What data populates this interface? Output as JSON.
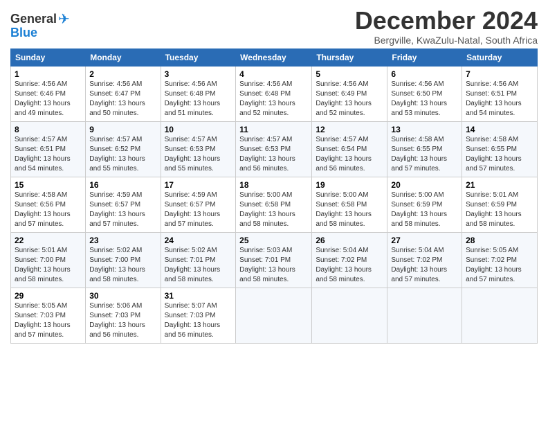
{
  "header": {
    "logo_general": "General",
    "logo_blue": "Blue",
    "title": "December 2024",
    "location": "Bergville, KwaZulu-Natal, South Africa"
  },
  "days_of_week": [
    "Sunday",
    "Monday",
    "Tuesday",
    "Wednesday",
    "Thursday",
    "Friday",
    "Saturday"
  ],
  "weeks": [
    [
      {
        "day": "1",
        "sunrise": "4:56 AM",
        "sunset": "6:46 PM",
        "daylight": "13 hours and 49 minutes."
      },
      {
        "day": "2",
        "sunrise": "4:56 AM",
        "sunset": "6:47 PM",
        "daylight": "13 hours and 50 minutes."
      },
      {
        "day": "3",
        "sunrise": "4:56 AM",
        "sunset": "6:48 PM",
        "daylight": "13 hours and 51 minutes."
      },
      {
        "day": "4",
        "sunrise": "4:56 AM",
        "sunset": "6:48 PM",
        "daylight": "13 hours and 52 minutes."
      },
      {
        "day": "5",
        "sunrise": "4:56 AM",
        "sunset": "6:49 PM",
        "daylight": "13 hours and 52 minutes."
      },
      {
        "day": "6",
        "sunrise": "4:56 AM",
        "sunset": "6:50 PM",
        "daylight": "13 hours and 53 minutes."
      },
      {
        "day": "7",
        "sunrise": "4:56 AM",
        "sunset": "6:51 PM",
        "daylight": "13 hours and 54 minutes."
      }
    ],
    [
      {
        "day": "8",
        "sunrise": "4:57 AM",
        "sunset": "6:51 PM",
        "daylight": "13 hours and 54 minutes."
      },
      {
        "day": "9",
        "sunrise": "4:57 AM",
        "sunset": "6:52 PM",
        "daylight": "13 hours and 55 minutes."
      },
      {
        "day": "10",
        "sunrise": "4:57 AM",
        "sunset": "6:53 PM",
        "daylight": "13 hours and 55 minutes."
      },
      {
        "day": "11",
        "sunrise": "4:57 AM",
        "sunset": "6:53 PM",
        "daylight": "13 hours and 56 minutes."
      },
      {
        "day": "12",
        "sunrise": "4:57 AM",
        "sunset": "6:54 PM",
        "daylight": "13 hours and 56 minutes."
      },
      {
        "day": "13",
        "sunrise": "4:58 AM",
        "sunset": "6:55 PM",
        "daylight": "13 hours and 57 minutes."
      },
      {
        "day": "14",
        "sunrise": "4:58 AM",
        "sunset": "6:55 PM",
        "daylight": "13 hours and 57 minutes."
      }
    ],
    [
      {
        "day": "15",
        "sunrise": "4:58 AM",
        "sunset": "6:56 PM",
        "daylight": "13 hours and 57 minutes."
      },
      {
        "day": "16",
        "sunrise": "4:59 AM",
        "sunset": "6:57 PM",
        "daylight": "13 hours and 57 minutes."
      },
      {
        "day": "17",
        "sunrise": "4:59 AM",
        "sunset": "6:57 PM",
        "daylight": "13 hours and 57 minutes."
      },
      {
        "day": "18",
        "sunrise": "5:00 AM",
        "sunset": "6:58 PM",
        "daylight": "13 hours and 58 minutes."
      },
      {
        "day": "19",
        "sunrise": "5:00 AM",
        "sunset": "6:58 PM",
        "daylight": "13 hours and 58 minutes."
      },
      {
        "day": "20",
        "sunrise": "5:00 AM",
        "sunset": "6:59 PM",
        "daylight": "13 hours and 58 minutes."
      },
      {
        "day": "21",
        "sunrise": "5:01 AM",
        "sunset": "6:59 PM",
        "daylight": "13 hours and 58 minutes."
      }
    ],
    [
      {
        "day": "22",
        "sunrise": "5:01 AM",
        "sunset": "7:00 PM",
        "daylight": "13 hours and 58 minutes."
      },
      {
        "day": "23",
        "sunrise": "5:02 AM",
        "sunset": "7:00 PM",
        "daylight": "13 hours and 58 minutes."
      },
      {
        "day": "24",
        "sunrise": "5:02 AM",
        "sunset": "7:01 PM",
        "daylight": "13 hours and 58 minutes."
      },
      {
        "day": "25",
        "sunrise": "5:03 AM",
        "sunset": "7:01 PM",
        "daylight": "13 hours and 58 minutes."
      },
      {
        "day": "26",
        "sunrise": "5:04 AM",
        "sunset": "7:02 PM",
        "daylight": "13 hours and 58 minutes."
      },
      {
        "day": "27",
        "sunrise": "5:04 AM",
        "sunset": "7:02 PM",
        "daylight": "13 hours and 57 minutes."
      },
      {
        "day": "28",
        "sunrise": "5:05 AM",
        "sunset": "7:02 PM",
        "daylight": "13 hours and 57 minutes."
      }
    ],
    [
      {
        "day": "29",
        "sunrise": "5:05 AM",
        "sunset": "7:03 PM",
        "daylight": "13 hours and 57 minutes."
      },
      {
        "day": "30",
        "sunrise": "5:06 AM",
        "sunset": "7:03 PM",
        "daylight": "13 hours and 56 minutes."
      },
      {
        "day": "31",
        "sunrise": "5:07 AM",
        "sunset": "7:03 PM",
        "daylight": "13 hours and 56 minutes."
      },
      null,
      null,
      null,
      null
    ]
  ]
}
